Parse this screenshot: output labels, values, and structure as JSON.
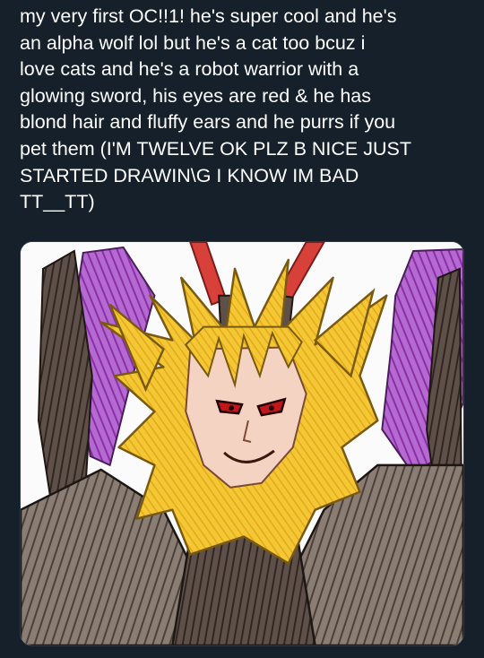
{
  "post": {
    "text": "my very first OC!!1! he's super cool and he's\nan alpha wolf lol but he's a cat too bcuz i\nlove cats and he's a robot warrior with a\nglowing sword, his eyes are red & he has\nblond hair and fluffy ears and he purrs if you\npet them (I'M TWELVE OK PLZ B NICE JUST\nSTARTED DRAWIN\\G I KNOW IM BAD\nTT__TT)"
  },
  "media": {
    "icon": "drawing-image"
  },
  "colors": {
    "background": "#15202b",
    "text": "#ffffff",
    "hair": "#f2c12e",
    "armor": "#6f625a",
    "wings": "#9b3fb4",
    "horns": "#d8403a",
    "skin": "#f5d3c2",
    "eyes": "#c0181a"
  }
}
